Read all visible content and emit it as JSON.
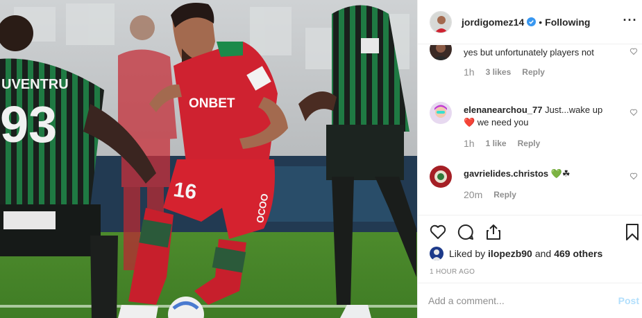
{
  "header": {
    "username": "jordigomez14",
    "separator": "•",
    "follow_status": "Following",
    "more_icon": "more-horizontal-icon"
  },
  "comments": [
    {
      "user": "",
      "text": "yes but unfortunately players not",
      "time": "1h",
      "likes": "3 likes",
      "reply": "Reply"
    },
    {
      "user": "elenanearchou_77",
      "text": "Just...wake up ❤️ we need you",
      "time": "1h",
      "likes": "1 like",
      "reply": "Reply"
    },
    {
      "user": "gavrielides.christos",
      "text": "💚☘",
      "time": "20m",
      "likes": "",
      "reply": "Reply"
    }
  ],
  "likes_line": {
    "prefix": "Liked by",
    "user": "ilopezb90",
    "conj": "and",
    "others": "469 others"
  },
  "time_ago": "1 HOUR AGO",
  "add_comment": {
    "placeholder": "Add a comment...",
    "post_label": "Post"
  },
  "photo": {
    "player_front_number": "16",
    "sponsor": "ONBET",
    "player_left_name": "UVENTRU",
    "player_left_number": "93",
    "brand": "OCOO"
  },
  "colors": {
    "verified": "#3897f0",
    "post_disabled": "#b2dffc",
    "meta_gray": "#8e8e8e",
    "red_kit": "#d11f2b",
    "green_kit": "#1b7a45"
  }
}
